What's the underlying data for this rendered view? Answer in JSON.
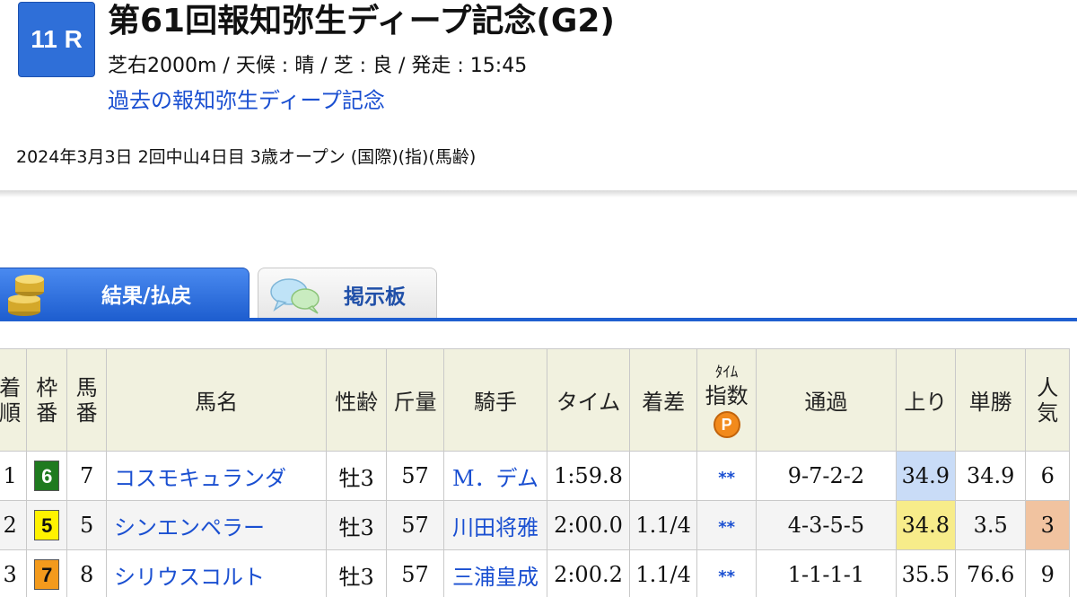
{
  "race": {
    "number": "11 R",
    "title": "第61回報知弥生ディープ記念(G2)",
    "meta": "芝右2000m / 天候 : 晴 / 芝 : 良 / 発走 : 15:45",
    "past_link": "過去の報知弥生ディープ記念",
    "info": "2024年3月3日 2回中山4日目 3歳オープン  (国際)(指)(馬齢)"
  },
  "tabs": [
    {
      "label": "結果/払戻",
      "icon": "coin-stack-icon",
      "active": true
    },
    {
      "label": "掲示板",
      "icon": "speech-bubble-icon",
      "active": false
    }
  ],
  "table": {
    "headers": {
      "rank": [
        "着",
        "順"
      ],
      "waku": [
        "枠",
        "番"
      ],
      "umaban": [
        "馬",
        "番"
      ],
      "horse": "馬名",
      "sex_age": "性齢",
      "weight": "斤量",
      "jockey": "騎手",
      "time": "タイム",
      "margin": "着差",
      "time_index": [
        "ﾀｲﾑ",
        "指数"
      ],
      "time_index_icon": "P",
      "passing": "通過",
      "last3f": "上り",
      "odds": "単勝",
      "popularity": [
        "人",
        "気"
      ]
    },
    "rows": [
      {
        "rank": "1",
        "waku": "6",
        "waku_color": "#1f7a1f",
        "waku_text": "#ffffff",
        "umaban": "7",
        "horse": "コスモキュランダ",
        "sex_age": "牡3",
        "weight": "57",
        "jockey": "M．デム",
        "time": "1:59.8",
        "margin": "",
        "index": "**",
        "passing": "9-7-2-2",
        "last3f": "34.9",
        "last3f_bg": "#c9dcf7",
        "odds": "34.9",
        "popularity": "6",
        "pop_bg": ""
      },
      {
        "rank": "2",
        "waku": "5",
        "waku_color": "#fff200",
        "waku_text": "#111111",
        "umaban": "5",
        "horse": "シンエンペラー",
        "sex_age": "牡3",
        "weight": "57",
        "jockey": "川田将雅",
        "time": "2:00.0",
        "margin": "1.1/4",
        "index": "**",
        "passing": "4-3-5-5",
        "last3f": "34.8",
        "last3f_bg": "#f7ec8a",
        "odds": "3.5",
        "popularity": "3",
        "pop_bg": "#f1c3a0"
      },
      {
        "rank": "3",
        "waku": "7",
        "waku_color": "#f39a1c",
        "waku_text": "#111111",
        "umaban": "8",
        "horse": "シリウスコルト",
        "sex_age": "牡3",
        "weight": "57",
        "jockey": "三浦皇成",
        "time": "2:00.2",
        "margin": "1.1/4",
        "index": "**",
        "passing": "1-1-1-1",
        "last3f": "35.5",
        "last3f_bg": "",
        "odds": "76.6",
        "popularity": "9",
        "pop_bg": ""
      }
    ]
  }
}
